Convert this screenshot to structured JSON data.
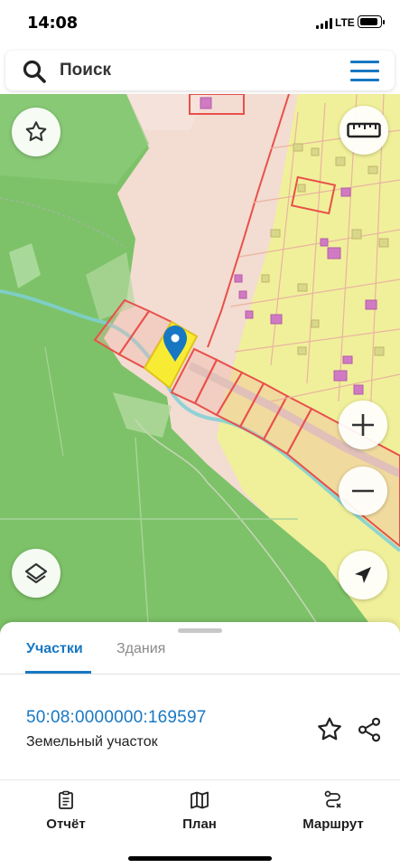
{
  "status_bar": {
    "time": "14:08",
    "network": "LTE"
  },
  "search": {
    "placeholder": "Поиск"
  },
  "map_controls": {
    "favorite": "star-icon",
    "ruler": "ruler-icon",
    "zoom_in": "plus-icon",
    "zoom_out": "minus-icon",
    "layers": "layers-icon",
    "locate": "navigation-arrow-icon"
  },
  "colors": {
    "accent": "#1878c3",
    "forest": "#7cc167",
    "residential": "#f0f08e",
    "parcel_border": "#e8504a",
    "selected_parcel": "#f7ec33",
    "pin": "#1777c2"
  },
  "sheet": {
    "tabs": [
      {
        "label": "Участки",
        "active": true
      },
      {
        "label": "Здания",
        "active": false
      }
    ],
    "parcel": {
      "cadastral_number": "50:08:0000000:169597",
      "type": "Земельный участок"
    }
  },
  "bottom_nav": [
    {
      "label": "Отчёт",
      "icon": "report-icon"
    },
    {
      "label": "План",
      "icon": "map-plan-icon"
    },
    {
      "label": "Маршрут",
      "icon": "route-icon"
    }
  ]
}
